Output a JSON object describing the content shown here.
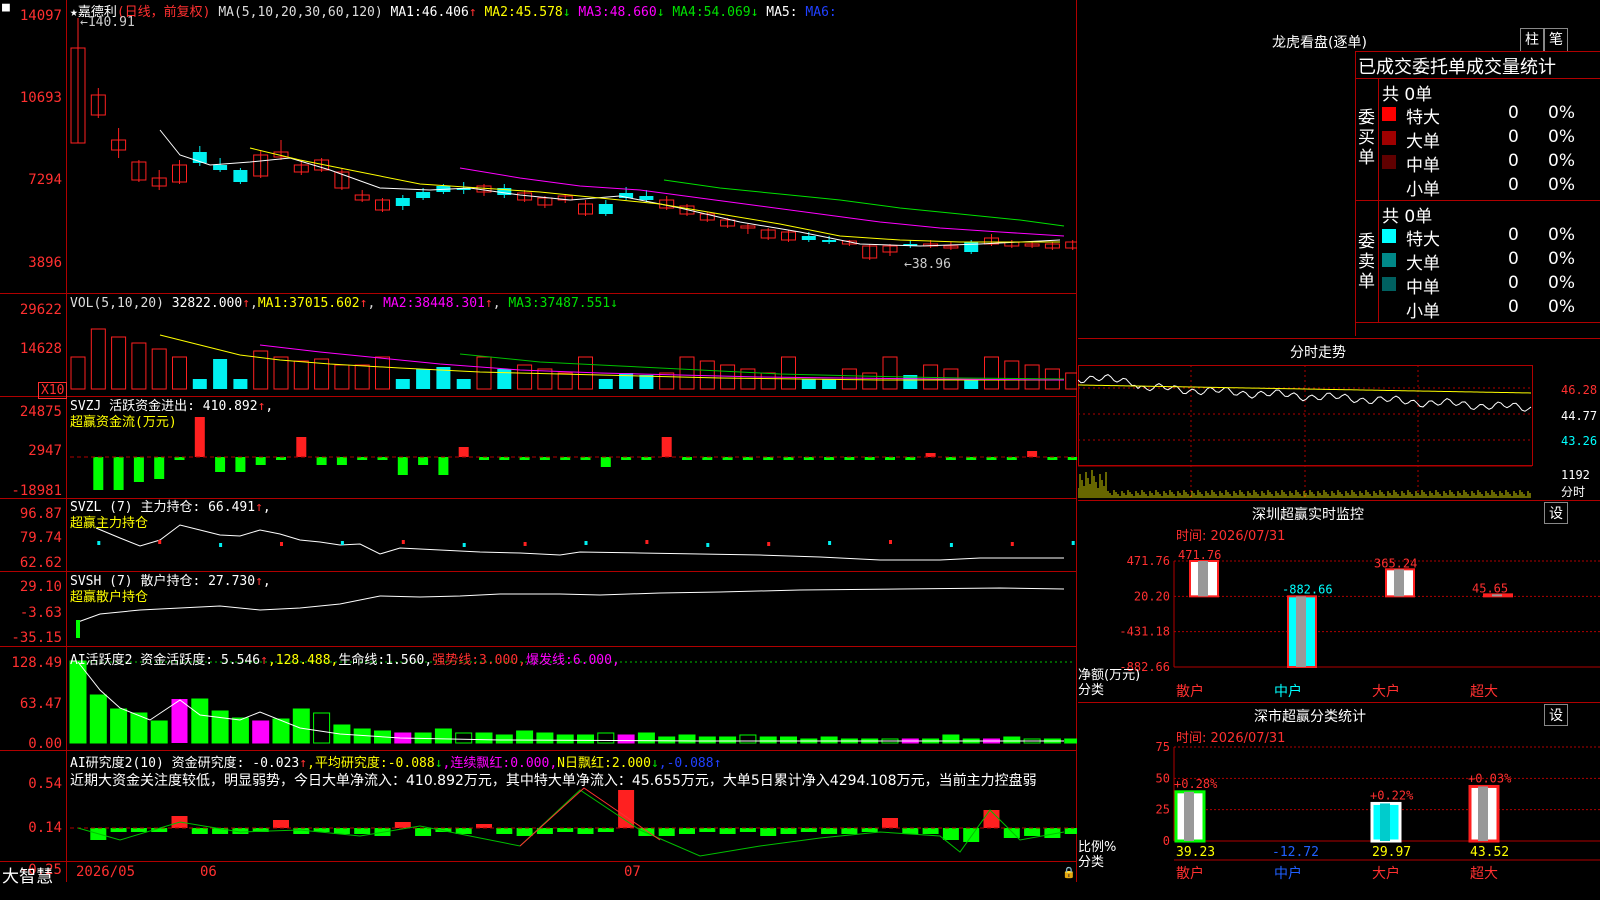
{
  "app": {
    "brand": "大智慧"
  },
  "stock": {
    "name": "嘉德利",
    "period": "(日线，前复权)"
  },
  "colors": {
    "up": "#ff2020",
    "down": "#00f0f0",
    "grid": "#b00000",
    "ma1": "#ffffff",
    "ma2": "#ffff00",
    "ma3": "#ff00ff",
    "ma4": "#00e000",
    "vol_ma3": "#00c000"
  },
  "kline": {
    "ma_header": "MA(5,10,20,30,60,120)",
    "ma": [
      {
        "label": "MA1:",
        "value": "46.406",
        "arrow": "↑"
      },
      {
        "label": "MA2:",
        "value": "45.578",
        "arrow": "↓"
      },
      {
        "label": "MA3:",
        "value": "48.660",
        "arrow": "↓"
      },
      {
        "label": "MA4:",
        "value": "54.069",
        "arrow": "↓"
      },
      {
        "label": "MA5:",
        "value": "",
        "arrow": ""
      },
      {
        "label": "MA6:",
        "value": "",
        "arrow": ""
      }
    ],
    "axis": [
      "14097",
      "10693",
      "7294",
      "3896"
    ],
    "high_label": "←140.91",
    "low_label": "←38.96"
  },
  "volume": {
    "header": "VOL(5,10,20)",
    "value": "32822.000",
    "arrow": "↑",
    "ma": [
      {
        "label": "MA1:",
        "value": "37015.602",
        "arrow": "↑"
      },
      {
        "label": "MA2:",
        "value": "38448.301",
        "arrow": "↑"
      },
      {
        "label": "MA3:",
        "value": "37487.551",
        "arrow": "↓"
      }
    ],
    "axis": [
      "29622",
      "14628"
    ],
    "unit": "X10"
  },
  "svzj": {
    "title": "SVZJ  活跃资金进出:",
    "value": "410.892",
    "arrow": "↑",
    "tail": ",",
    "subtitle": "超赢资金流(万元)",
    "axis": [
      "24875",
      "2947",
      "-18981"
    ]
  },
  "svzl": {
    "title": "SVZL (7) 主力持仓:",
    "value": "66.491",
    "arrow": "↑",
    "tail": ",",
    "subtitle": "超赢主力持仓",
    "axis": [
      "96.87",
      "79.74",
      "62.62"
    ]
  },
  "svsh": {
    "title": "SVSH (7) 散户持仓:",
    "value": "27.730",
    "arrow": "↑",
    "tail": ",",
    "subtitle": "超赢散户持仓",
    "axis": [
      "29.10",
      "-3.63",
      "-35.15"
    ]
  },
  "ai_active": {
    "title": "AI活跃度2 资金活跃度:",
    "value": "5.546",
    "arrow": "↑",
    "v2": ",128.488,",
    "life_label": "生命线:",
    "life": "1.560,",
    "strong_label": "强势线:",
    "strong": "3.000,",
    "burst_label": "爆发线:",
    "burst": "6.000,",
    "axis": [
      "128.49",
      "63.47",
      "0.00"
    ]
  },
  "ai_research": {
    "title": "AI研究度2(10) 资金研究度:",
    "value": "-0.023",
    "arrow": "↑",
    "avg_label": ",平均研究度:",
    "avg": "-0.088",
    "avg_arrow": "↓",
    "cont_label": ",连续飘红:",
    "cont": "0.000,",
    "n_label": "N日飘红:",
    "n": "2.000",
    "n_arrow": "↓",
    "tail": ",-0.088↑",
    "comment": "近期大资金关注度较低，明显弱势，今日大单净流入：410.892万元，其中特大单净流入：45.655万元，大单5日累计净入4294.108万元，当前主力控盘弱",
    "axis": [
      "0.54",
      "0.14",
      "-0.25"
    ]
  },
  "xaxis": {
    "labels": [
      "2026/05",
      "06",
      "07"
    ]
  },
  "dragon": {
    "title": "龙虎看盘(逐单)",
    "btn1": "柱",
    "btn2": "笔",
    "tabs": "已成交委托单成交量统计",
    "buy": {
      "label": "委买单",
      "total": "共 0单",
      "rows": [
        {
          "name": "特大",
          "qty": "0",
          "pct": "0%",
          "color": "#ff0000"
        },
        {
          "name": "大单",
          "qty": "0",
          "pct": "0%",
          "color": "#a00000"
        },
        {
          "name": "中单",
          "qty": "0",
          "pct": "0%",
          "color": "#600000"
        },
        {
          "name": "小单",
          "qty": "0",
          "pct": "0%",
          "color": ""
        }
      ]
    },
    "sell": {
      "label": "委卖单",
      "total": "共 0单",
      "rows": [
        {
          "name": "特大",
          "qty": "0",
          "pct": "0%",
          "color": "#00ffff"
        },
        {
          "name": "大单",
          "qty": "0",
          "pct": "0%",
          "color": "#008888"
        },
        {
          "name": "中单",
          "qty": "0",
          "pct": "0%",
          "color": "#006060"
        },
        {
          "name": "小单",
          "qty": "0",
          "pct": "0%",
          "color": ""
        }
      ]
    }
  },
  "intraday": {
    "title": "分时走势",
    "axis": [
      "46.28",
      "44.77",
      "43.26"
    ],
    "vol_axis": [
      "1192",
      "分时"
    ]
  },
  "sz_monitor": {
    "title": "深圳超赢实时监控",
    "btn": "设",
    "time": "时间: 2026/07/31",
    "axis": [
      "471.76",
      "20.20",
      "-431.18",
      "-882.66"
    ],
    "ylabel1": "净额(万元)",
    "ylabel2": "分类",
    "categories": [
      "散户",
      "中户",
      "大户",
      "超大"
    ],
    "chart_data": {
      "type": "bar",
      "categories": [
        "散户",
        "中户",
        "大户",
        "超大"
      ],
      "values": [
        471.76,
        -882.66,
        365.24,
        45.65
      ],
      "labels": [
        "471.76",
        "-882.66",
        "365.24",
        "45.65"
      ],
      "ylim": [
        -882.66,
        471.76
      ]
    }
  },
  "sz_class": {
    "title": "深市超赢分类统计",
    "btn": "设",
    "time": "时间: 2026/07/31",
    "axis": [
      "75",
      "50",
      "25",
      "0"
    ],
    "ylabel1": "比例%",
    "ylabel2": "分类",
    "categories": [
      "散户",
      "中户",
      "大户",
      "超大"
    ],
    "chart_data": {
      "type": "bar",
      "categories": [
        "散户",
        "中户",
        "大户",
        "超大"
      ],
      "values": [
        39.23,
        -12.72,
        29.97,
        43.52
      ],
      "value_labels": [
        "39.23",
        "-12.72",
        "29.97",
        "43.52"
      ],
      "changes": [
        "+0.28%",
        "",
        "+0.22%",
        "+0.03%"
      ],
      "ylim": [
        0,
        75
      ]
    }
  }
}
